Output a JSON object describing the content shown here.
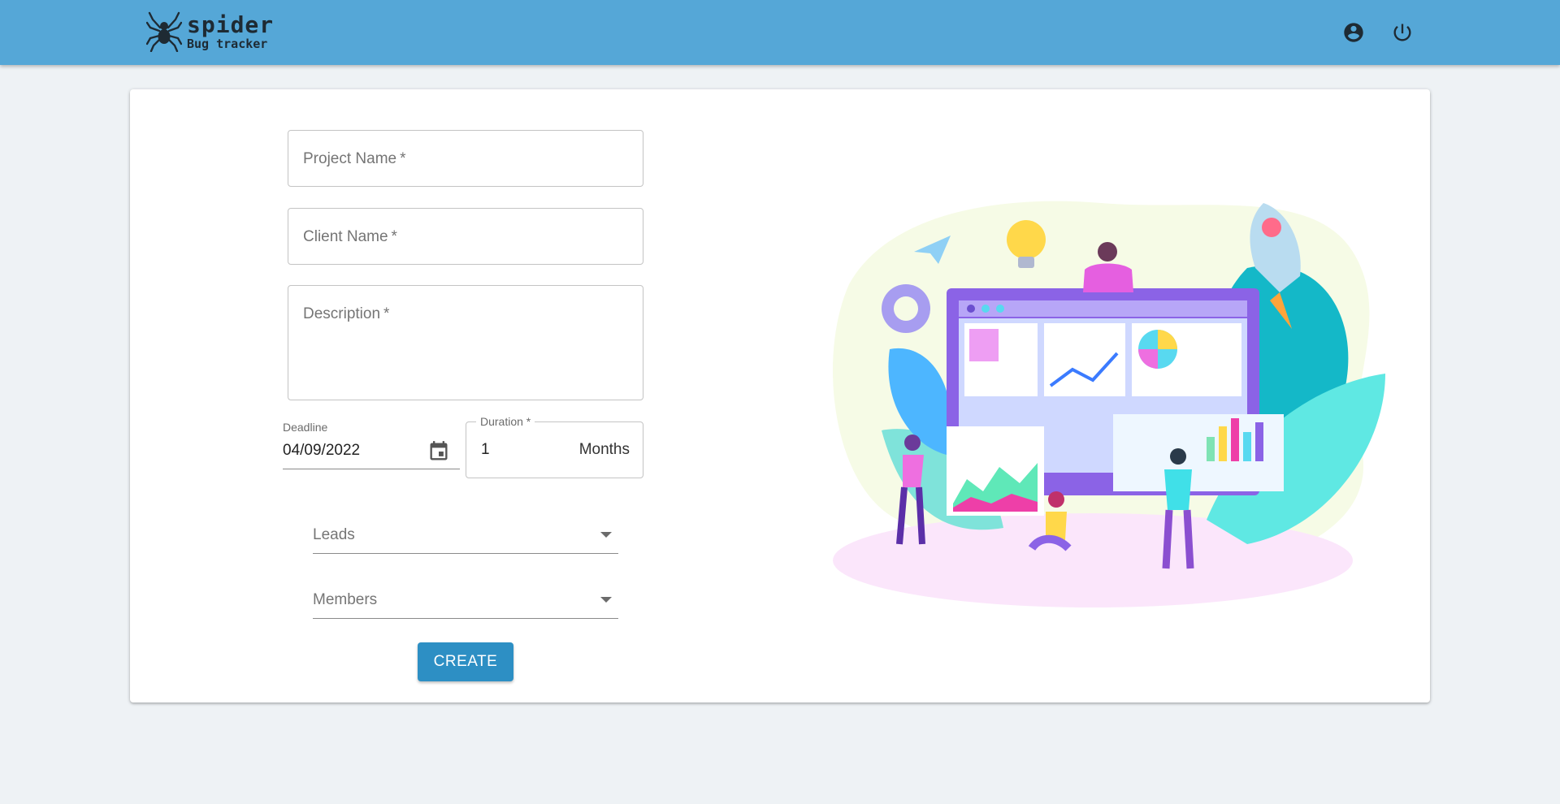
{
  "header": {
    "brand_name": "spider",
    "brand_tagline": "Bug tracker",
    "account_icon": "account-circle-icon",
    "power_icon": "power-icon",
    "accent_color": "#55a7d7"
  },
  "form": {
    "project_name": {
      "placeholder": "Project Name",
      "required_mark": "*"
    },
    "client_name": {
      "placeholder": "Client Name",
      "required_mark": "*"
    },
    "description": {
      "placeholder": "Description",
      "required_mark": "*"
    },
    "deadline": {
      "label": "Deadline",
      "value": "04/09/2022",
      "icon": "calendar-icon"
    },
    "duration": {
      "label": "Duration *",
      "value": "1",
      "unit": "Months"
    },
    "leads": {
      "placeholder": "Leads"
    },
    "members": {
      "placeholder": "Members"
    },
    "create_label": "CREATE",
    "button_color": "#2d8fc4"
  },
  "illustration": {
    "description_icon": "team-dashboard-illustration"
  }
}
